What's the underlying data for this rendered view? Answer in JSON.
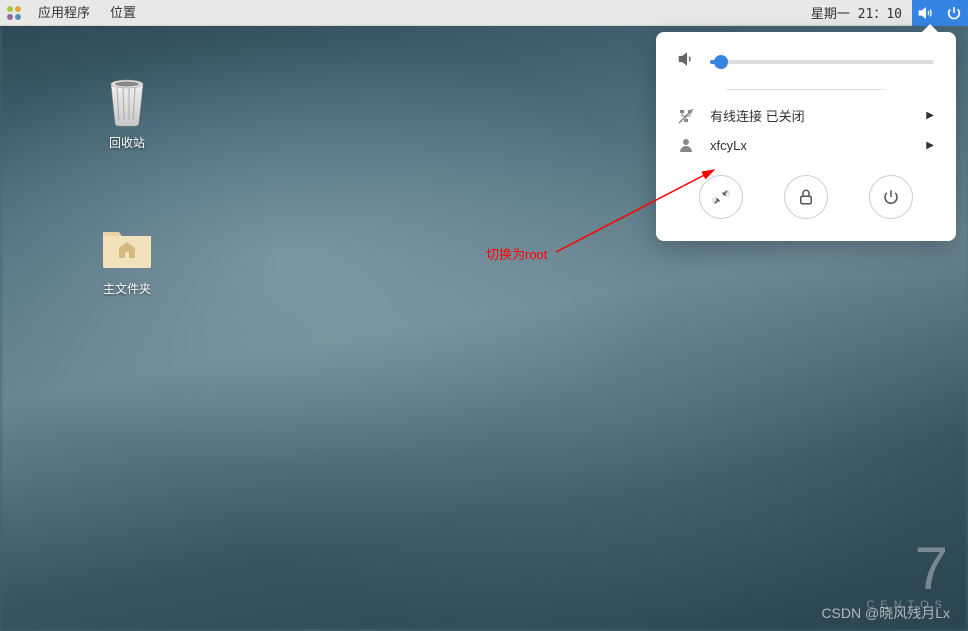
{
  "panel": {
    "applications": "应用程序",
    "places": "位置",
    "clock": "星期一 21：10"
  },
  "desktop": {
    "trash": "回收站",
    "home": "主文件夹"
  },
  "popup": {
    "volume_percent": 5,
    "network": "有线连接 已关闭",
    "user": "xfcyLx"
  },
  "annotation": "切换为root",
  "brand": {
    "version": "7",
    "name": "CENTOS"
  },
  "watermark": "CSDN @晓风残月Lx"
}
